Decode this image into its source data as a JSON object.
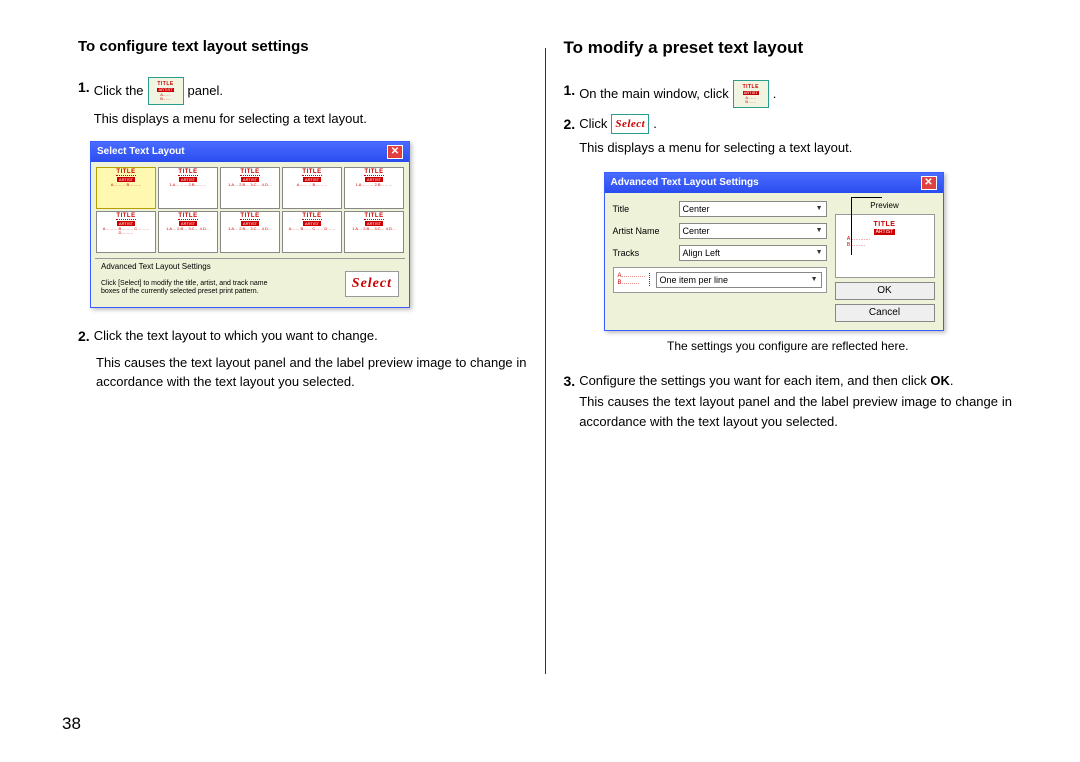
{
  "page_number": "38",
  "left": {
    "heading": "To configure text layout settings",
    "step1_a": "Click the",
    "step1_b": "panel.",
    "step1_desc": "This displays a menu for selecting a text layout.",
    "dialog": {
      "title": "Select Text Layout",
      "cell_title": "TITLE",
      "cell_artist": "ARTIST",
      "r1": [
        "A………  B………",
        "1.A………  2.B………",
        "1.A…  2.B…  3.C…  4.D…",
        "A………  B………",
        "1.A………  2.B………"
      ],
      "r2": [
        "A………  B………  C………  D………",
        "1.A…  2.B…  3.C…  4.D…",
        "1.A…  2.B…  3.C…  4.D…",
        "A……  B……  C……  D……",
        "1.A…  2.B…  3.C…  4.D…"
      ],
      "adv_title": "Advanced Text Layout Settings",
      "adv_text": "Click [Select] to modify the title, artist, and track name boxes of the currently selected preset print pattern.",
      "select_btn": "Select"
    },
    "step2": "Click the text layout to which you want to change.",
    "step2_desc": "This causes the text layout panel and the label preview image to change in accordance with the text layout you selected."
  },
  "right": {
    "heading": "To modify a preset text layout",
    "step1": "On the main window, click",
    "step2": "Click",
    "step2_desc": "This displays a menu for selecting a text layout.",
    "dialog": {
      "title": "Advanced Text Layout Settings",
      "lbl_title": "Title",
      "val_title": "Center",
      "lbl_artist": "Artist Name",
      "val_artist": "Center",
      "lbl_tracks": "Tracks",
      "val_tracks": "Align Left",
      "lbl_itemper": "One item per line",
      "preview_hdr": "Preview",
      "pv_title": "TITLE",
      "pv_artist": "ARTIST",
      "btn_ok": "OK",
      "btn_cancel": "Cancel"
    },
    "caption": "The settings you configure are reflected here.",
    "step3_a": "Configure the settings you want for each item, and then click",
    "step3_b": "OK",
    "step3_c": ".",
    "step3_desc": "This causes the text layout panel and the label preview image to change in accordance with the text layout you selected."
  }
}
